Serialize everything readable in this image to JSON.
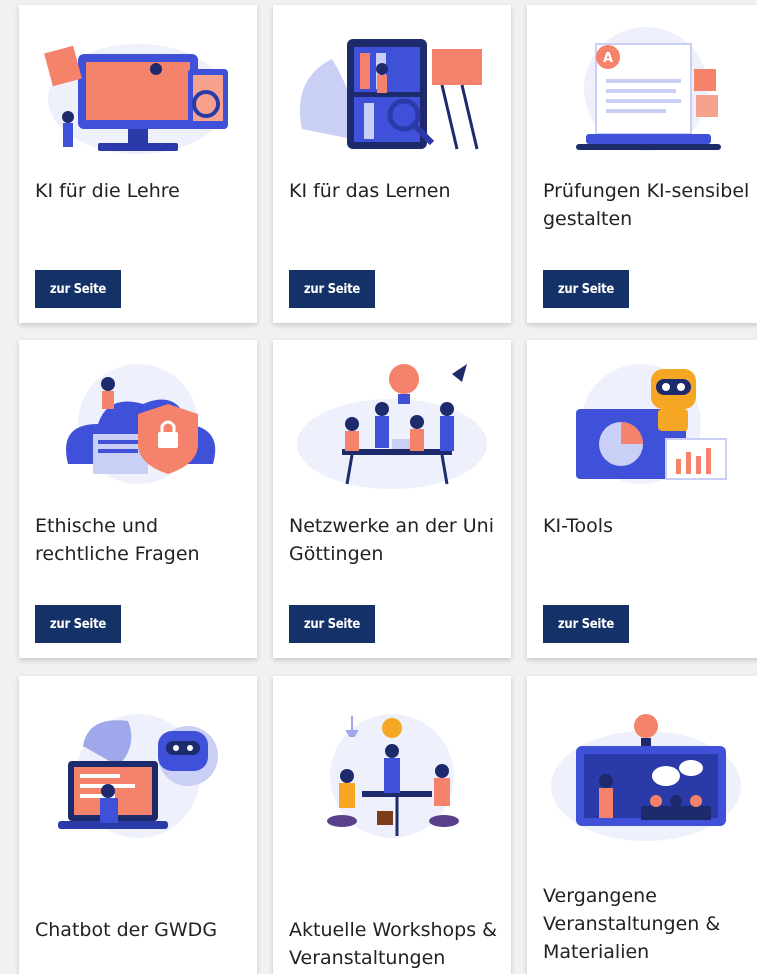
{
  "colors": {
    "button_bg": "#153268",
    "accent_blue": "#3f51d9",
    "accent_orange": "#f5826b",
    "page_bg": "#f1f1f3"
  },
  "cards": [
    {
      "title": "KI für die Lehre",
      "button": "zur Seite",
      "icon": "teacher-monitor-illustration"
    },
    {
      "title": "KI für das Lernen",
      "button": "zur Seite",
      "icon": "bookshelf-learning-illustration"
    },
    {
      "title": "Prüfungen KI-sensibel gestalten",
      "button": "zur Seite",
      "icon": "exam-laptop-illustration"
    },
    {
      "title": "Ethische und rechtliche Fragen",
      "button": "zur Seite",
      "icon": "security-cloud-illustration"
    },
    {
      "title": "Netzwerke an der Uni Göttingen",
      "button": "zur Seite",
      "icon": "team-network-illustration"
    },
    {
      "title": "KI-Tools",
      "button": "",
      "icon": "robot-tools-illustration",
      "button_label": "zur Seite"
    },
    {
      "title": "Chatbot der GWDG",
      "icon": "chatbot-laptop-illustration"
    },
    {
      "title": "Aktuelle Workshops & Veranstaltungen",
      "icon": "workshop-illustration"
    },
    {
      "title": "Vergangene Veranstaltungen & Materialien",
      "icon": "presentation-illustration"
    }
  ]
}
